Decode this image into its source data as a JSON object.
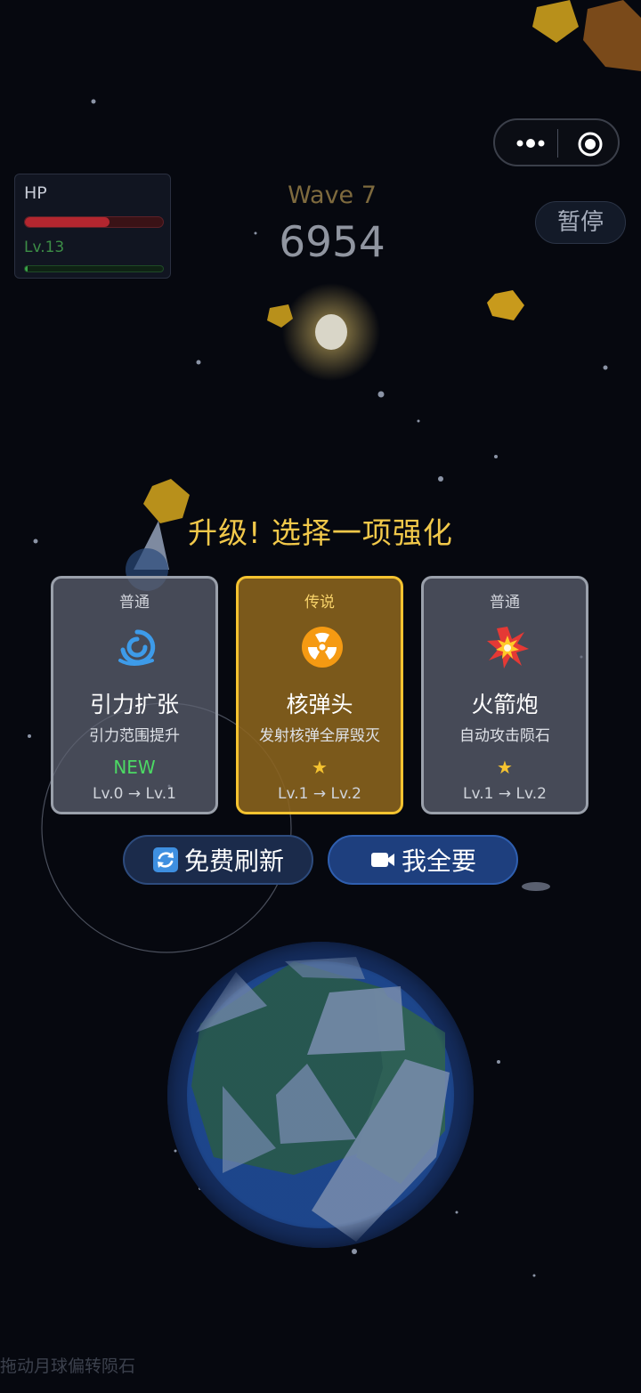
{
  "capsule": {
    "menu_icon": "more-dots-icon",
    "close_icon": "target-circle-icon"
  },
  "hud": {
    "hp_label": "HP",
    "hp_fraction": 0.61,
    "level_label": "Lv.13",
    "xp_fraction": 0.02,
    "wave_label": "Wave 7",
    "score": "6954",
    "pause_label": "暂停"
  },
  "upgrade": {
    "title": "升级! 选择一项强化",
    "cards": [
      {
        "rarity": "普通",
        "icon": "gravity-swirl-icon",
        "name": "引力扩张",
        "desc": "引力范围提升",
        "tag": "NEW",
        "level": "Lv.0 → Lv.1"
      },
      {
        "rarity": "传说",
        "icon": "radiation-icon",
        "name": "核弹头",
        "desc": "发射核弹全屏毁灭",
        "star": "★",
        "level": "Lv.1 → Lv.2"
      },
      {
        "rarity": "普通",
        "icon": "explosion-icon",
        "name": "火箭炮",
        "desc": "自动攻击陨石",
        "star": "★",
        "level": "Lv.1 → Lv.2"
      }
    ],
    "refresh_label": "免费刷新",
    "refresh_icon": "refresh-icon",
    "take_all_label": "我全要",
    "take_all_icon": "video-camera-icon"
  },
  "hint": "拖动月球偏转陨石",
  "colors": {
    "accent": "#f5c330",
    "hp": "#b3262f",
    "xp": "#3aa34a",
    "new": "#4cd964",
    "button": "#1e3f7e"
  }
}
